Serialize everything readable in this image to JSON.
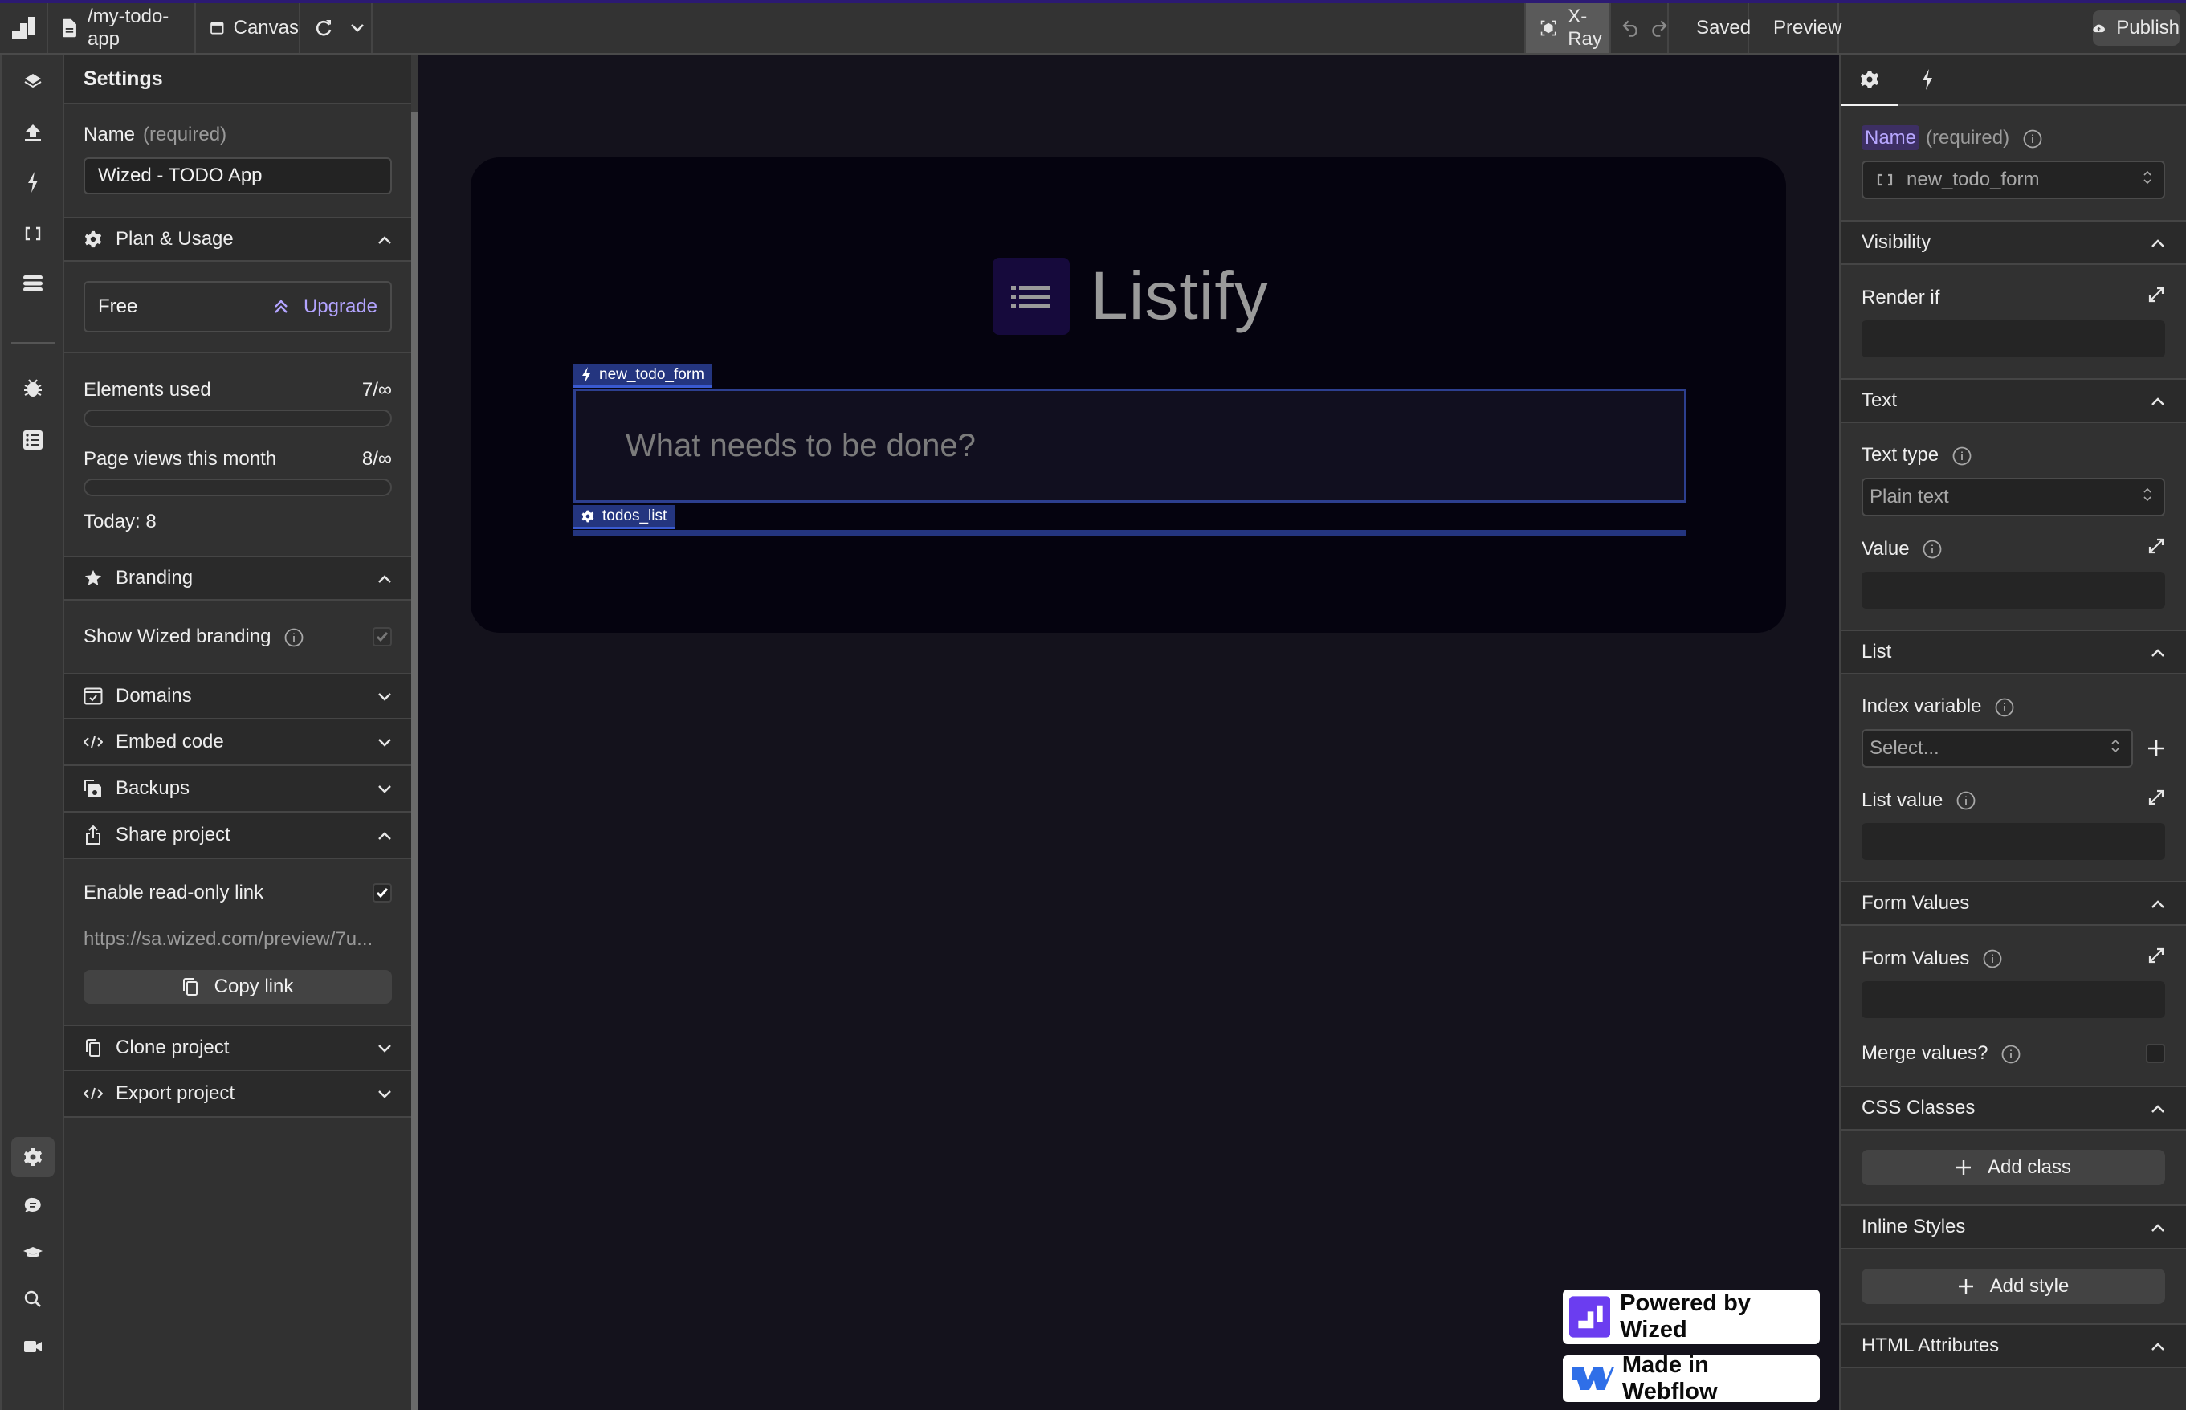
{
  "topbar": {
    "page_path": "/my-todo-app",
    "canvas_label": "Canvas",
    "xray_label": "X-Ray",
    "saved_label": "Saved",
    "preview_label": "Preview",
    "publish_label": "Publish",
    "saved_color": "#a8f0a8",
    "top_accent_color": "#2c1a73"
  },
  "rail": {
    "top_items": [
      "layers-icon",
      "upload-icon",
      "bolt-icon",
      "brackets-icon",
      "data-icon"
    ],
    "bottom_items": [
      "bug-icon",
      "list-icon"
    ],
    "footer_items": [
      "settings-icon",
      "chat-icon",
      "graduation-cap-icon",
      "search-icon",
      "video-icon"
    ],
    "active": "settings-icon"
  },
  "settings": {
    "title": "Settings",
    "name_label": "Name",
    "name_required": "(required)",
    "name_value": "Wized - TODO App",
    "plan": {
      "title": "Plan & Usage",
      "plan_name": "Free",
      "upgrade_label": "Upgrade",
      "upgrade_color": "#b3a4ff",
      "elements_label": "Elements used",
      "elements_value": "7/∞",
      "elements_fraction": 0,
      "pageviews_label": "Page views this month",
      "pageviews_value": "8/∞",
      "pageviews_fraction": 0,
      "today_label": "Today: 8"
    },
    "branding": {
      "title": "Branding",
      "show_label": "Show Wized branding",
      "show_checked": true
    },
    "domains_title": "Domains",
    "embed_title": "Embed code",
    "backups_title": "Backups",
    "share": {
      "title": "Share project",
      "enable_label": "Enable read-only link",
      "enable_checked": true,
      "link": "https://sa.wized.com/preview/7u...",
      "copy_label": "Copy link"
    },
    "clone_title": "Clone project",
    "export_title": "Export project"
  },
  "canvas": {
    "brand_name": "Listify",
    "form_tag": "new_todo_form",
    "input_placeholder": "What needs to be done?",
    "list_tag": "todos_list",
    "badge_wized": "Powered by Wized",
    "badge_webflow": "Made in Webflow",
    "wized_color": "#6b3df0",
    "webflow_color": "#2f6fe8"
  },
  "inspector": {
    "tabs": [
      "settings-tab",
      "actions-tab"
    ],
    "name_label": "Name",
    "name_required": "(required)",
    "element_name": "new_todo_form",
    "visibility_title": "Visibility",
    "render_if_label": "Render if",
    "text_title": "Text",
    "text_type_label": "Text type",
    "text_type_value": "Plain text",
    "value_label": "Value",
    "list_title": "List",
    "index_variable_label": "Index variable",
    "index_variable_placeholder": "Select...",
    "list_value_label": "List value",
    "form_values_title": "Form Values",
    "form_values_label": "Form Values",
    "merge_values_label": "Merge values?",
    "merge_values_checked": false,
    "css_classes_title": "CSS Classes",
    "add_class_label": "Add class",
    "inline_styles_title": "Inline Styles",
    "add_style_label": "Add style",
    "html_attributes_title": "HTML Attributes"
  }
}
